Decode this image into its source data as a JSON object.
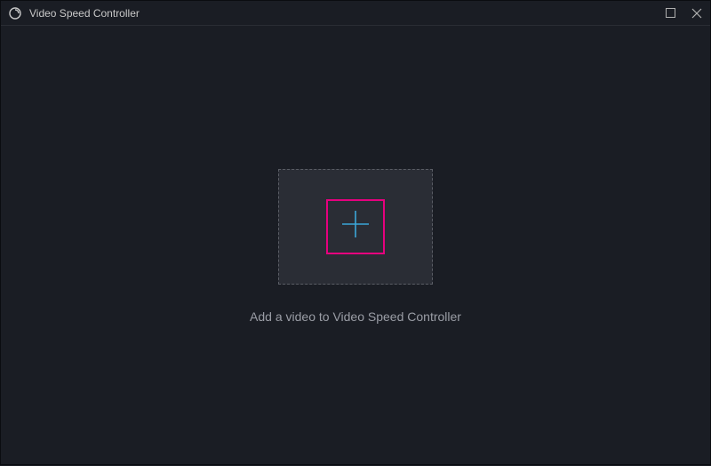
{
  "titlebar": {
    "app_title": "Video Speed Controller"
  },
  "main": {
    "prompt_text": "Add a video to Video Speed Controller"
  },
  "colors": {
    "background": "#1a1d24",
    "dropzone_bg": "#2a2d35",
    "highlight_border": "#e6007e",
    "plus_icon": "#3ba7d9",
    "text_light": "#c8c8c8",
    "text_muted": "#9a9da5"
  }
}
